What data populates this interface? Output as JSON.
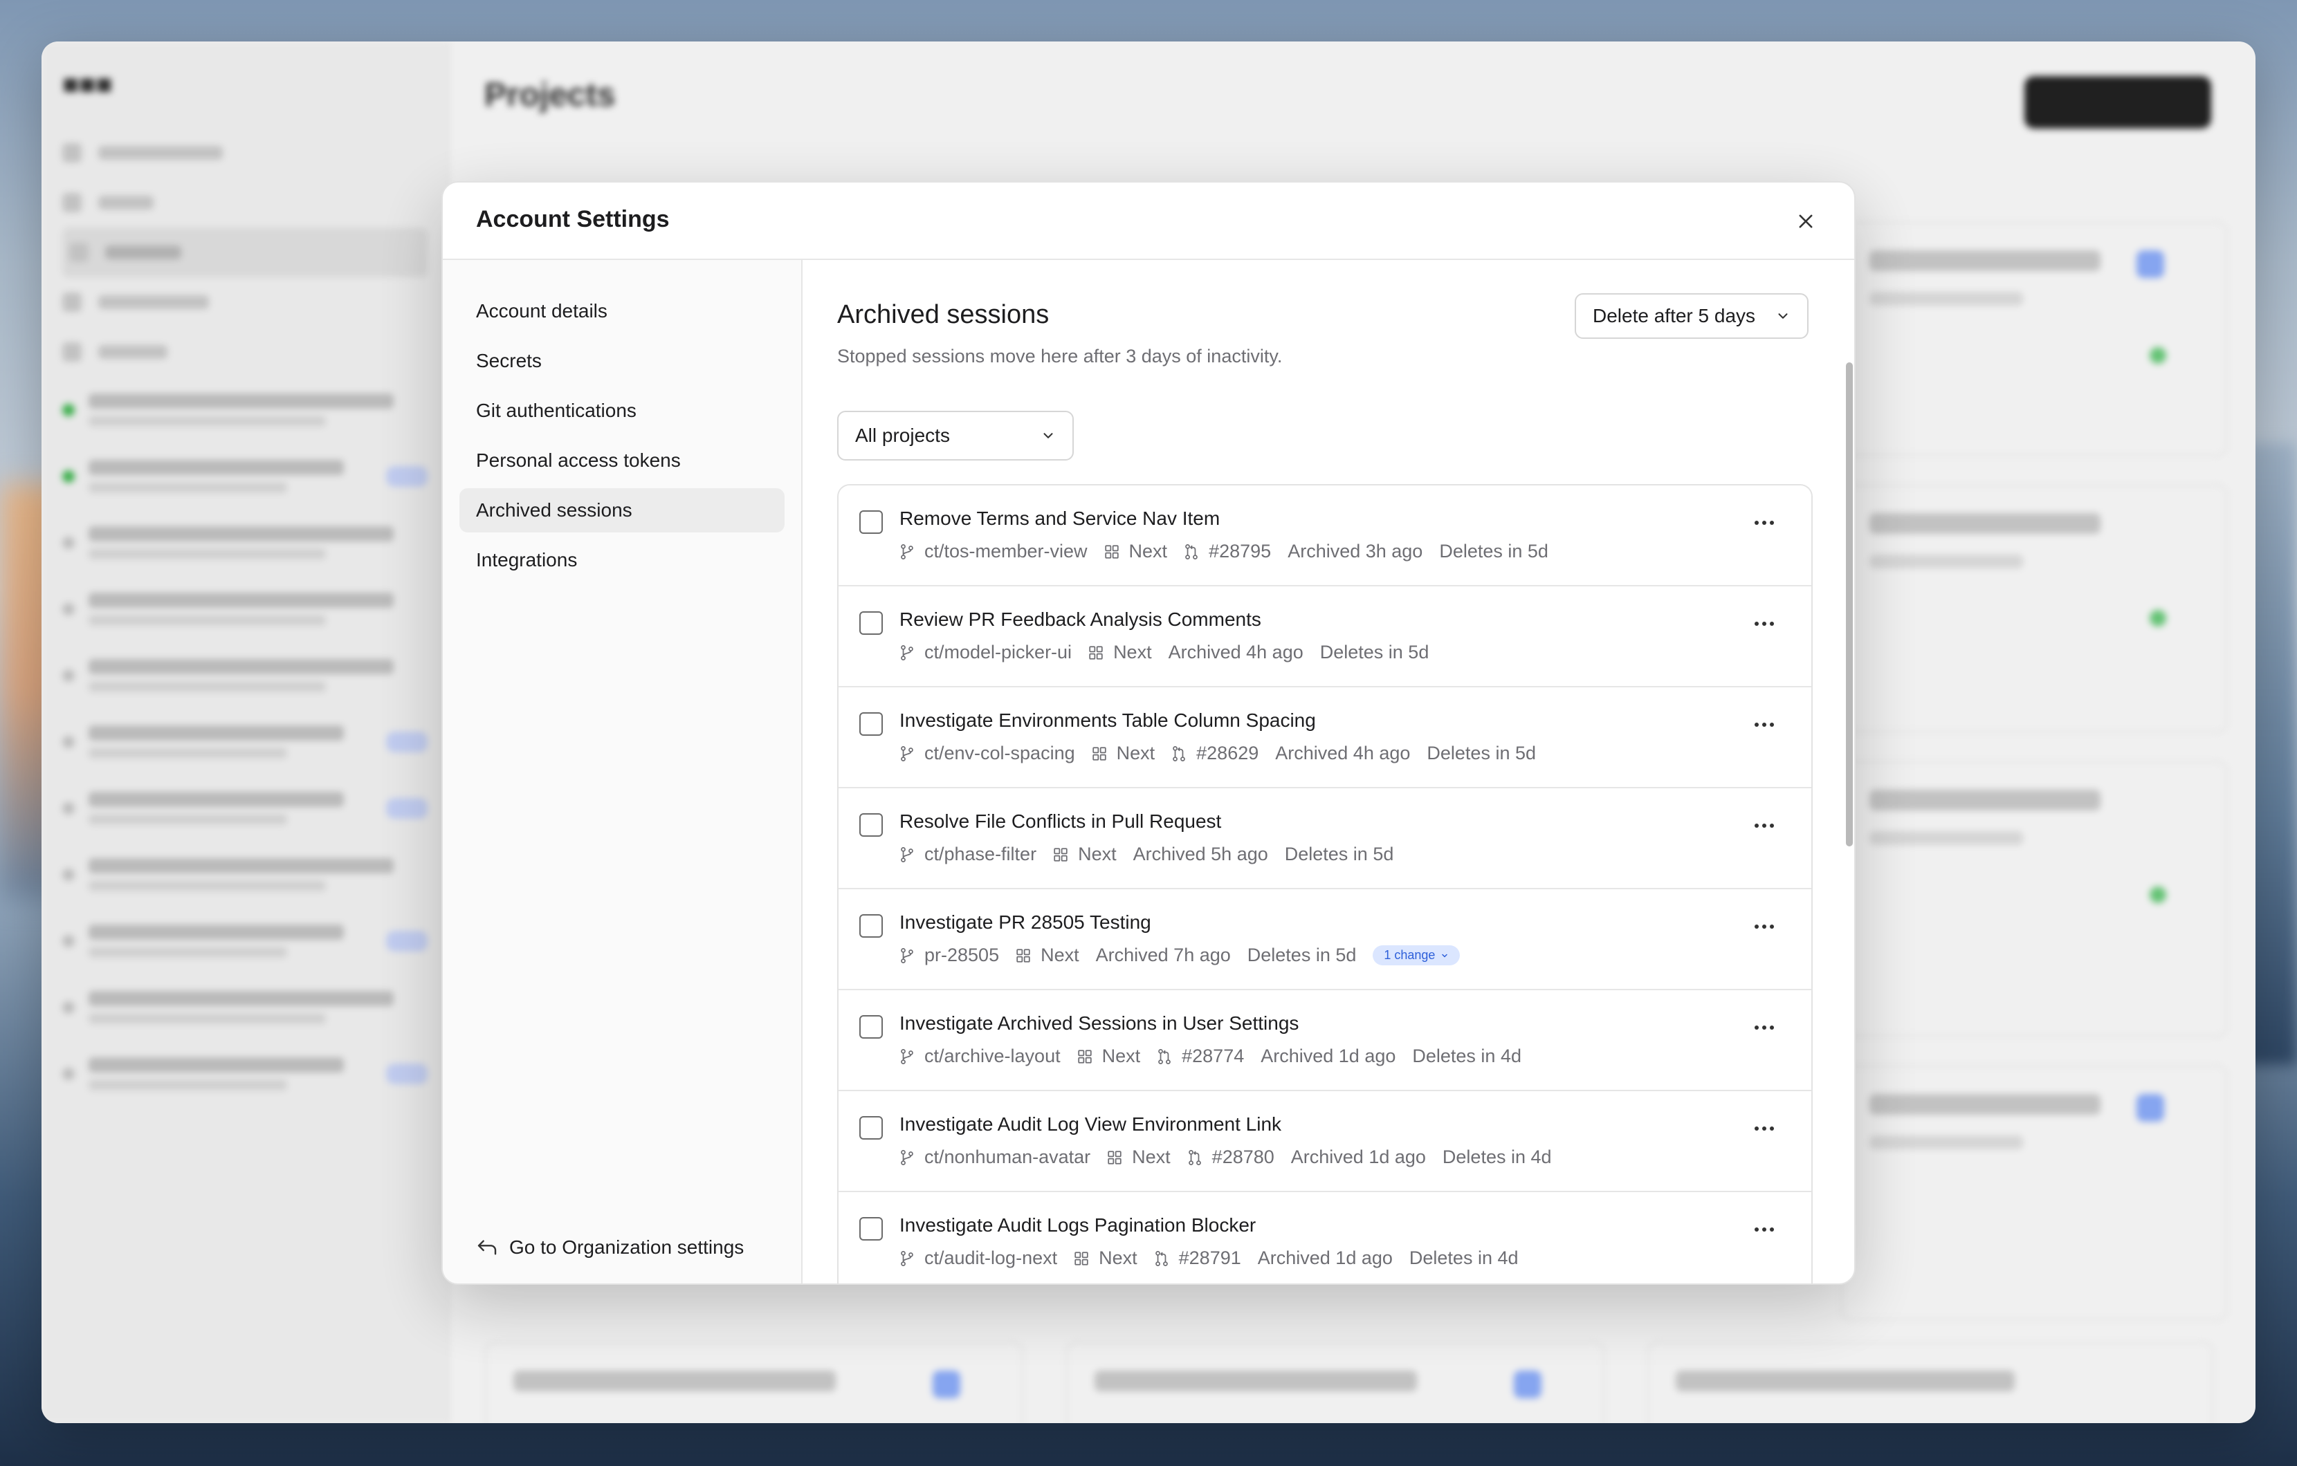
{
  "modal": {
    "title": "Account Settings"
  },
  "nav": {
    "items": [
      {
        "label": "Account details",
        "active": false
      },
      {
        "label": "Secrets",
        "active": false
      },
      {
        "label": "Git authentications",
        "active": false
      },
      {
        "label": "Personal access tokens",
        "active": false
      },
      {
        "label": "Archived sessions",
        "active": true
      },
      {
        "label": "Integrations",
        "active": false
      }
    ],
    "org_link": "Go to Organization settings"
  },
  "archived": {
    "title": "Archived sessions",
    "description": "Stopped sessions move here after 3 days of inactivity.",
    "retention_value": "Delete after 5 days",
    "project_filter": "All projects"
  },
  "sessions": [
    {
      "title": "Remove Terms and Service Nav Item",
      "branch": "ct/tos-member-view",
      "env": "Next",
      "pr": "#28795",
      "archived": "Archived 3h ago",
      "deletes": "Deletes in 5d"
    },
    {
      "title": "Review PR Feedback Analysis Comments",
      "branch": "ct/model-picker-ui",
      "env": "Next",
      "pr": "",
      "archived": "Archived 4h ago",
      "deletes": "Deletes in 5d"
    },
    {
      "title": "Investigate Environments Table Column Spacing",
      "branch": "ct/env-col-spacing",
      "env": "Next",
      "pr": "#28629",
      "archived": "Archived 4h ago",
      "deletes": "Deletes in 5d"
    },
    {
      "title": "Resolve File Conflicts in Pull Request",
      "branch": "ct/phase-filter",
      "env": "Next",
      "pr": "",
      "archived": "Archived 5h ago",
      "deletes": "Deletes in 5d"
    },
    {
      "title": "Investigate PR 28505 Testing",
      "branch": "pr-28505",
      "env": "Next",
      "pr": "",
      "archived": "Archived 7h ago",
      "deletes": "Deletes in 5d",
      "badge": "1 change"
    },
    {
      "title": "Investigate Archived Sessions in User Settings",
      "branch": "ct/archive-layout",
      "env": "Next",
      "pr": "#28774",
      "archived": "Archived 1d ago",
      "deletes": "Deletes in 4d"
    },
    {
      "title": "Investigate Audit Log View Environment Link",
      "branch": "ct/nonhuman-avatar",
      "env": "Next",
      "pr": "#28780",
      "archived": "Archived 1d ago",
      "deletes": "Deletes in 4d"
    },
    {
      "title": "Investigate Audit Logs Pagination Blocker",
      "branch": "ct/audit-log-next",
      "env": "Next",
      "pr": "#28791",
      "archived": "Archived 1d ago",
      "deletes": "Deletes in 4d"
    }
  ],
  "background": {
    "page_title": "Projects"
  },
  "icons": {
    "close": "close-icon",
    "chevron": "chevron-down-icon",
    "branch": "git-branch-icon",
    "environment": "grid-icon",
    "pull_request": "pull-request-icon",
    "more": "more-horizontal-icon",
    "back": "arrow-back-icon"
  },
  "colors": {
    "badge_bg": "#dbe6ff",
    "badge_text": "#2d5fd9",
    "active_nav": "#ececec"
  }
}
